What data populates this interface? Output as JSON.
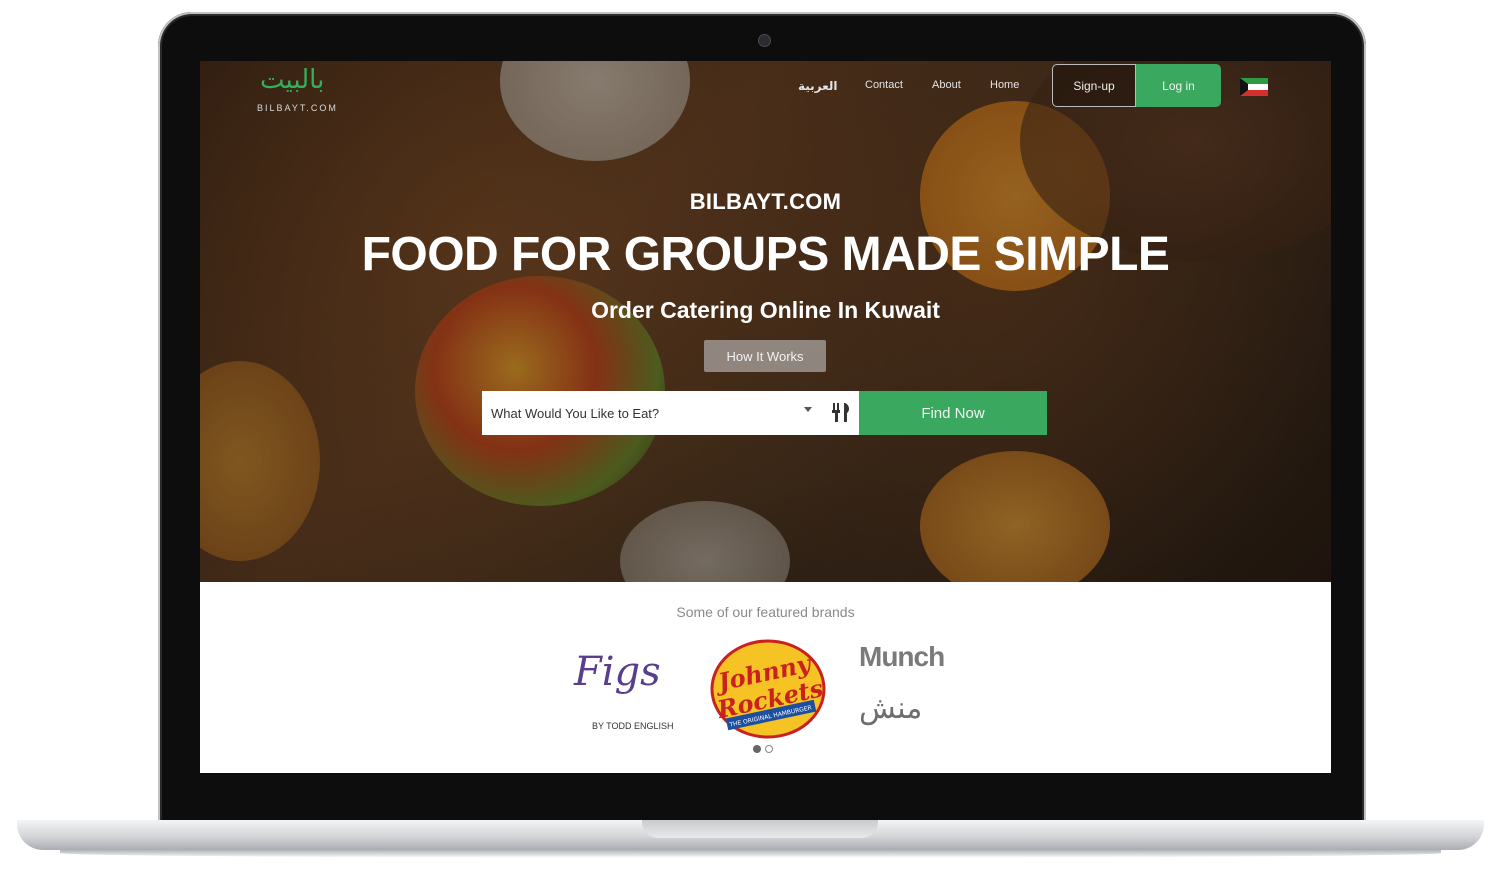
{
  "site": {
    "logo_ar": "بالبيت",
    "logo_en": "BILBAYT.COM"
  },
  "nav": {
    "arabic": "العربية",
    "contact": "Contact",
    "about": "About",
    "home": "Home",
    "signup": "Sign-up",
    "login": "Log in"
  },
  "hero": {
    "brand": "BILBAYT.COM",
    "headline": "FOOD FOR GROUPS MADE SIMPLE",
    "subheadline": "Order Catering Online In Kuwait",
    "how_it_works": "How It Works",
    "search": {
      "value": "What Would You Like to Eat?"
    },
    "find_now": "Find Now"
  },
  "featured": {
    "title": "Some of our featured brands",
    "brands": [
      {
        "name": "Figs",
        "tagline": "BY TODD ENGLISH"
      },
      {
        "name": "Johnny Rockets",
        "tagline": "THE ORIGINAL HAMBURGER"
      },
      {
        "name": "Munch",
        "name_ar": "منش"
      }
    ],
    "carousel": {
      "pages": 2,
      "active": 1
    }
  },
  "colors": {
    "accent_green": "#3aa85f",
    "logo_green": "#33b05c"
  }
}
